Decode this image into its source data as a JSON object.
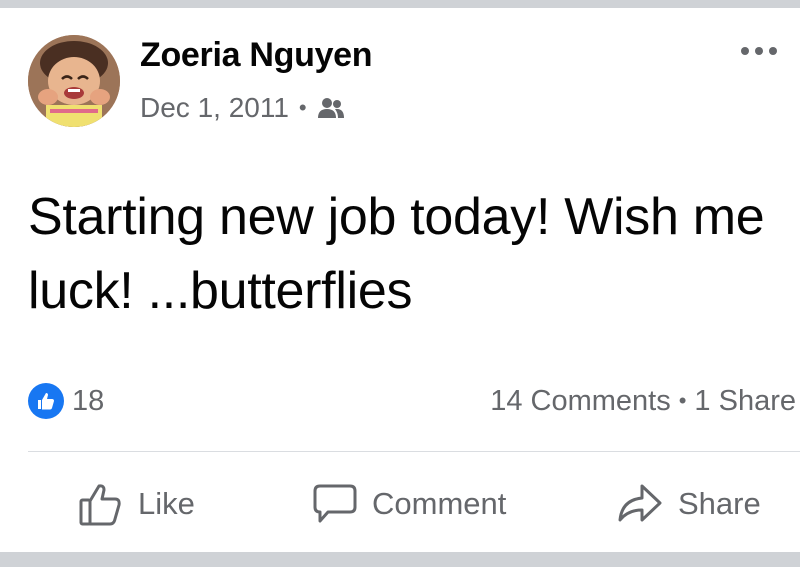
{
  "post": {
    "author": "Zoeria Nguyen",
    "date": "Dec 1, 2011",
    "meta_separator": "•",
    "audience_icon": "friends-icon",
    "text": "Starting new job today! Wish me luck! ...butterflies"
  },
  "stats": {
    "reaction_icon": "like-icon",
    "reaction_count": "18",
    "comments": "14 Comments",
    "separator": "•",
    "shares": "1 Share"
  },
  "actions": {
    "like_label": "Like",
    "comment_label": "Comment",
    "share_label": "Share"
  },
  "colors": {
    "accent": "#1877f2",
    "text_primary": "#050505",
    "text_secondary": "#65676b",
    "frame_bar": "#cfd2d6"
  }
}
